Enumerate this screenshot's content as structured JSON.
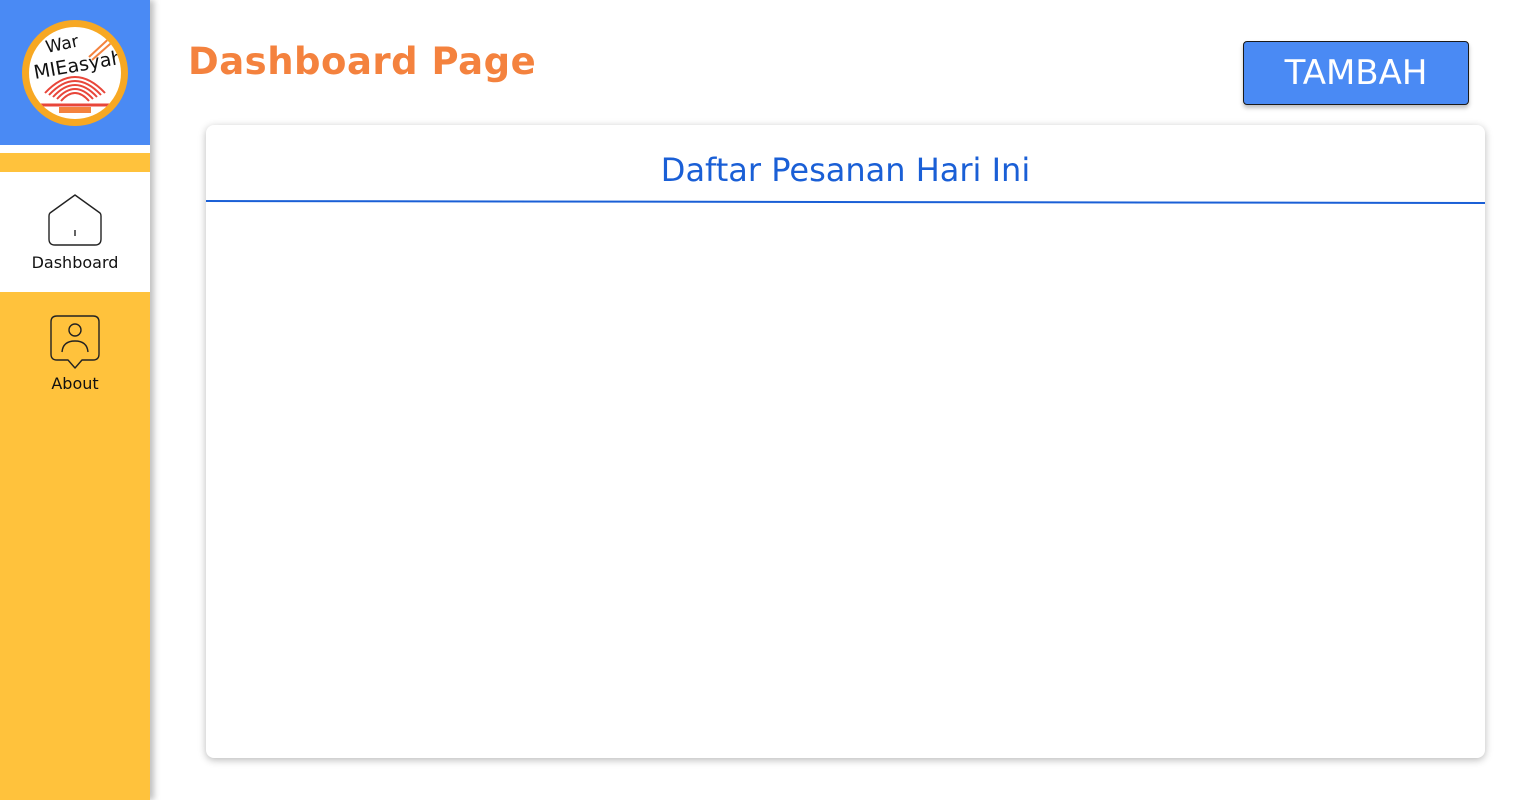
{
  "brand": {
    "logo_text_top": "War",
    "logo_text_bottom": "MIEasyah",
    "colors": {
      "sidebar": "#FFC23C",
      "logo_bg": "#4A8AF4",
      "title": "#F4823E",
      "button": "#4A8AF4",
      "card_title": "#1A5FD6"
    }
  },
  "sidebar": {
    "items": [
      {
        "label": "Dashboard",
        "icon": "home-icon",
        "active": true
      },
      {
        "label": "About",
        "icon": "user-profile-icon",
        "active": false
      }
    ]
  },
  "header": {
    "title": "Dashboard Page",
    "add_button_label": "TAMBAH"
  },
  "card": {
    "title": "Daftar Pesanan Hari Ini"
  }
}
